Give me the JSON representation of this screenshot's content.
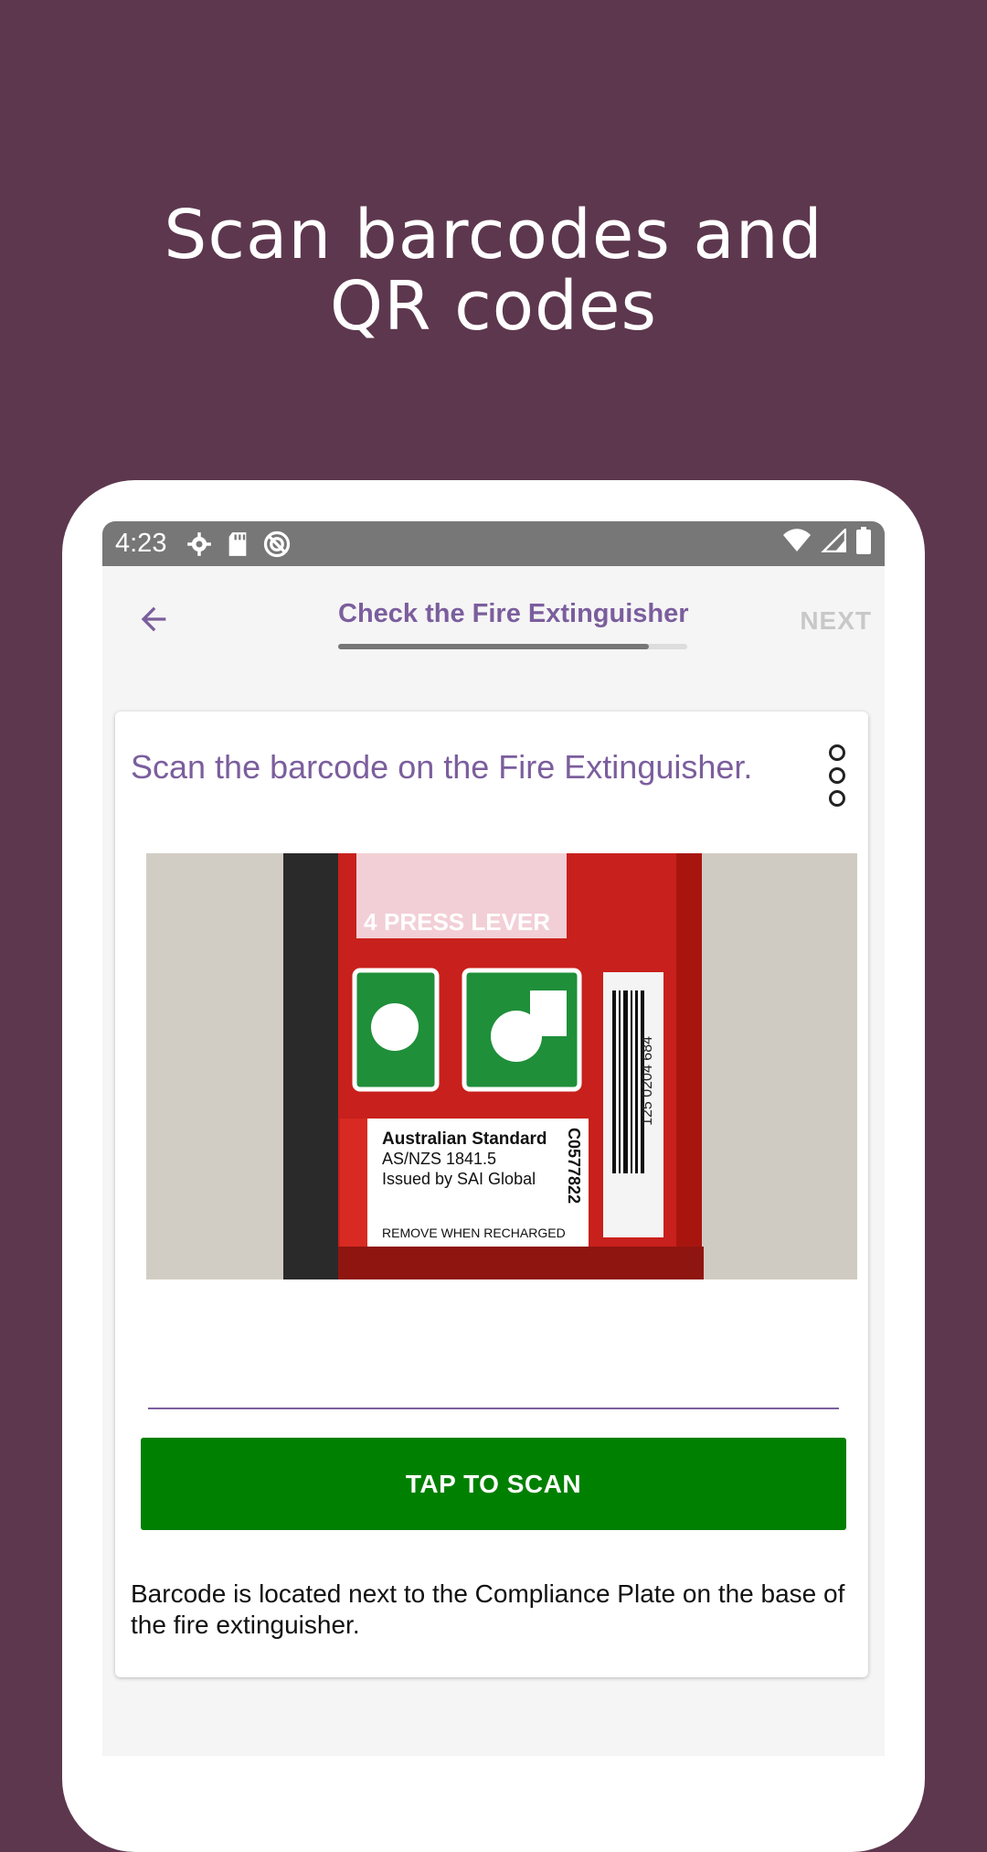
{
  "headline": {
    "line1": "Scan barcodes and",
    "line2": "QR codes"
  },
  "statusbar": {
    "time": "4:23",
    "icons": [
      "settings-icon",
      "sd-card-icon",
      "sync-icon",
      "wifi-icon",
      "signal-icon",
      "battery-icon"
    ]
  },
  "appbar": {
    "title": "Check the Fire Extinguisher",
    "next_label": "NEXT",
    "progress": 0.89
  },
  "card": {
    "question": "Scan the barcode on the Fire Extinguisher.",
    "scan_button_label": "TAP TO SCAN",
    "help_text": "Barcode is located next to the Compliance Plate on the base of the fire extinguisher."
  },
  "photo": {
    "press_lever": "PRESS LEVER",
    "step_number": "4",
    "label_line1": "Australian Standard",
    "label_line2": "AS/NZS 1841.5",
    "label_line3": "Issued by SAI Global",
    "label_serial": "C0577822",
    "label_footer": "REMOVE WHEN RECHARGED",
    "barcode_number": "125 0204 684"
  },
  "colors": {
    "background": "#5d374e",
    "accent": "#7b5e9d",
    "scan_button": "#008000",
    "statusbar": "#777777"
  }
}
